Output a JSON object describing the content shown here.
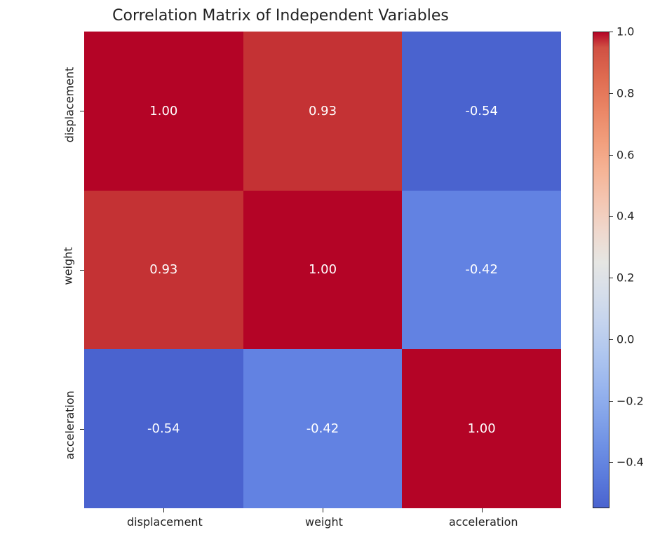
{
  "chart_data": {
    "type": "heatmap",
    "title": "Correlation Matrix of Independent Variables",
    "x_labels": [
      "displacement",
      "weight",
      "acceleration"
    ],
    "y_labels": [
      "displacement",
      "weight",
      "acceleration"
    ],
    "matrix": [
      [
        1.0,
        0.93,
        -0.54
      ],
      [
        0.93,
        1.0,
        -0.42
      ],
      [
        -0.54,
        -0.42,
        1.0
      ]
    ],
    "matrix_display": [
      [
        "1.00",
        "0.93",
        "-0.54"
      ],
      [
        "0.93",
        "1.00",
        "-0.42"
      ],
      [
        "-0.54",
        "-0.42",
        "1.00"
      ]
    ],
    "cell_colors": [
      [
        "#b40426",
        "#c43234",
        "#4a63cf"
      ],
      [
        "#c43234",
        "#b40426",
        "#6282e2"
      ],
      [
        "#4a63cf",
        "#6282e2",
        "#b40426"
      ]
    ],
    "colorbar": {
      "ticks": [
        1.0,
        0.8,
        0.6,
        0.4,
        0.2,
        0.0,
        -0.2,
        -0.4
      ],
      "tick_labels": [
        "1.0",
        "0.8",
        "0.6",
        "0.4",
        "0.2",
        "0.0",
        "−0.2",
        "−0.4"
      ],
      "vmin_approx": -0.55,
      "vmax": 1.0
    }
  }
}
